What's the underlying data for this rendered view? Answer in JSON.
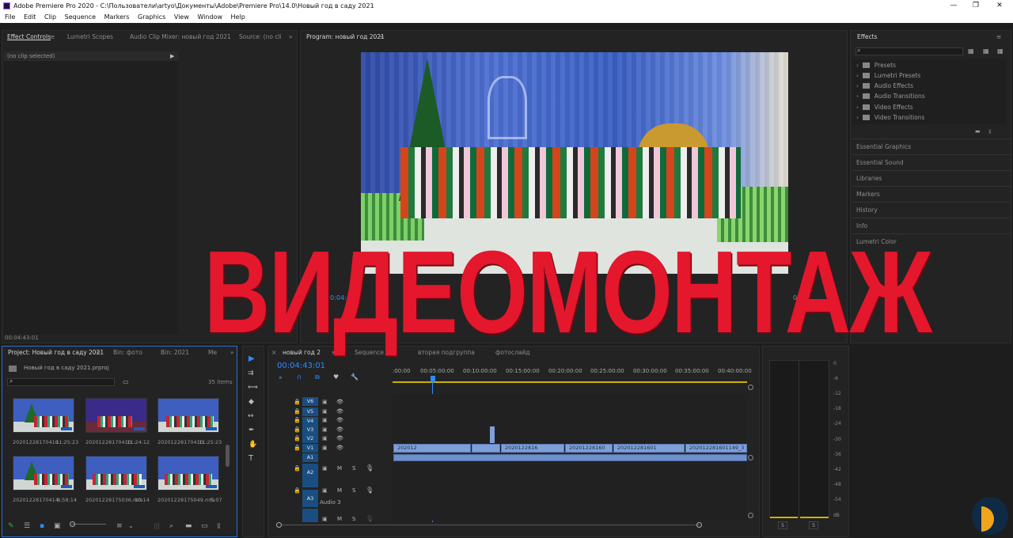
{
  "app": {
    "title": "Adobe Premiere Pro 2020 - C:\\Пользователи\\artyo\\Документы\\Adobe\\Premiere Pro\\14.0\\Новый год в саду 2021",
    "window_controls": [
      "—",
      "❐",
      "✕"
    ]
  },
  "menu": [
    "File",
    "Edit",
    "Clip",
    "Sequence",
    "Markers",
    "Graphics",
    "View",
    "Window",
    "Help"
  ],
  "source_panel": {
    "tabs": [
      "Effect Controls",
      "Lumetri Scopes",
      "Audio Clip Mixer: новый год 2021",
      "Source: (no cli"
    ],
    "no_clip": "(no clip selected)",
    "timecode": "00:04:43:01"
  },
  "program_monitor": {
    "tab": "Program: новый год 2021",
    "timecode_left": "00:04:43",
    "timecode_right": "00:04"
  },
  "overlay_text": "ВИДЕОМОНТАЖ",
  "effects_panel": {
    "title": "Effects",
    "folders": [
      "Presets",
      "Lumetri Presets",
      "Audio Effects",
      "Audio Transitions",
      "Video Effects",
      "Video Transitions"
    ],
    "sections": [
      "Essential Graphics",
      "Essential Sound",
      "Libraries",
      "Markers",
      "History",
      "Info",
      "Lumetri Color"
    ]
  },
  "project_panel": {
    "tabs": [
      "Project: Новый год в саду 2021",
      "Bin: фото",
      "Bin: 2021",
      "Ме"
    ],
    "file": "Новый год в саду 2021.prproj",
    "count": "35 items",
    "items": [
      {
        "name": "20201228170410...",
        "duration": "11:25:23"
      },
      {
        "name": "20201228170410...",
        "duration": "11:24:12"
      },
      {
        "name": "20201228170410...",
        "duration": "11:25:23"
      },
      {
        "name": "20201228170414...",
        "duration": "8:58:14"
      },
      {
        "name": "20201228175036.mts",
        "duration": "10:14"
      },
      {
        "name": "20201228175049.mts",
        "duration": "5:07"
      }
    ]
  },
  "timeline": {
    "tabs": [
      "новый год 2",
      "Sequence 02",
      "вторая подгруппа",
      "фотослайд"
    ],
    "timecode": "00:04:43:01",
    "ruler": [
      ":00:00",
      "00:05:00:00",
      "00:10:00:00",
      "00:15:00:00",
      "00:20:00:00",
      "00:25:00:00",
      "00:30:00:00",
      "00:35:00:00",
      "00:40:00:00"
    ],
    "video_tracks": [
      "V6",
      "V5",
      "V4",
      "V3",
      "V2",
      "V1"
    ],
    "audio_tracks": [
      "A1",
      "A2",
      "A3"
    ],
    "audio3_label": "Audio 3",
    "clip_labels": [
      "202012",
      "2020122816",
      "20201228160",
      "202012281601",
      "202012281601149_3"
    ],
    "track_buttons": {
      "m": "M",
      "s": "S"
    }
  },
  "meters": {
    "scale": [
      "0",
      "-6",
      "-12",
      "-18",
      "-24",
      "-30",
      "-36",
      "-42",
      "-48",
      "-54",
      "dB"
    ],
    "solo": [
      "S",
      "S"
    ]
  }
}
